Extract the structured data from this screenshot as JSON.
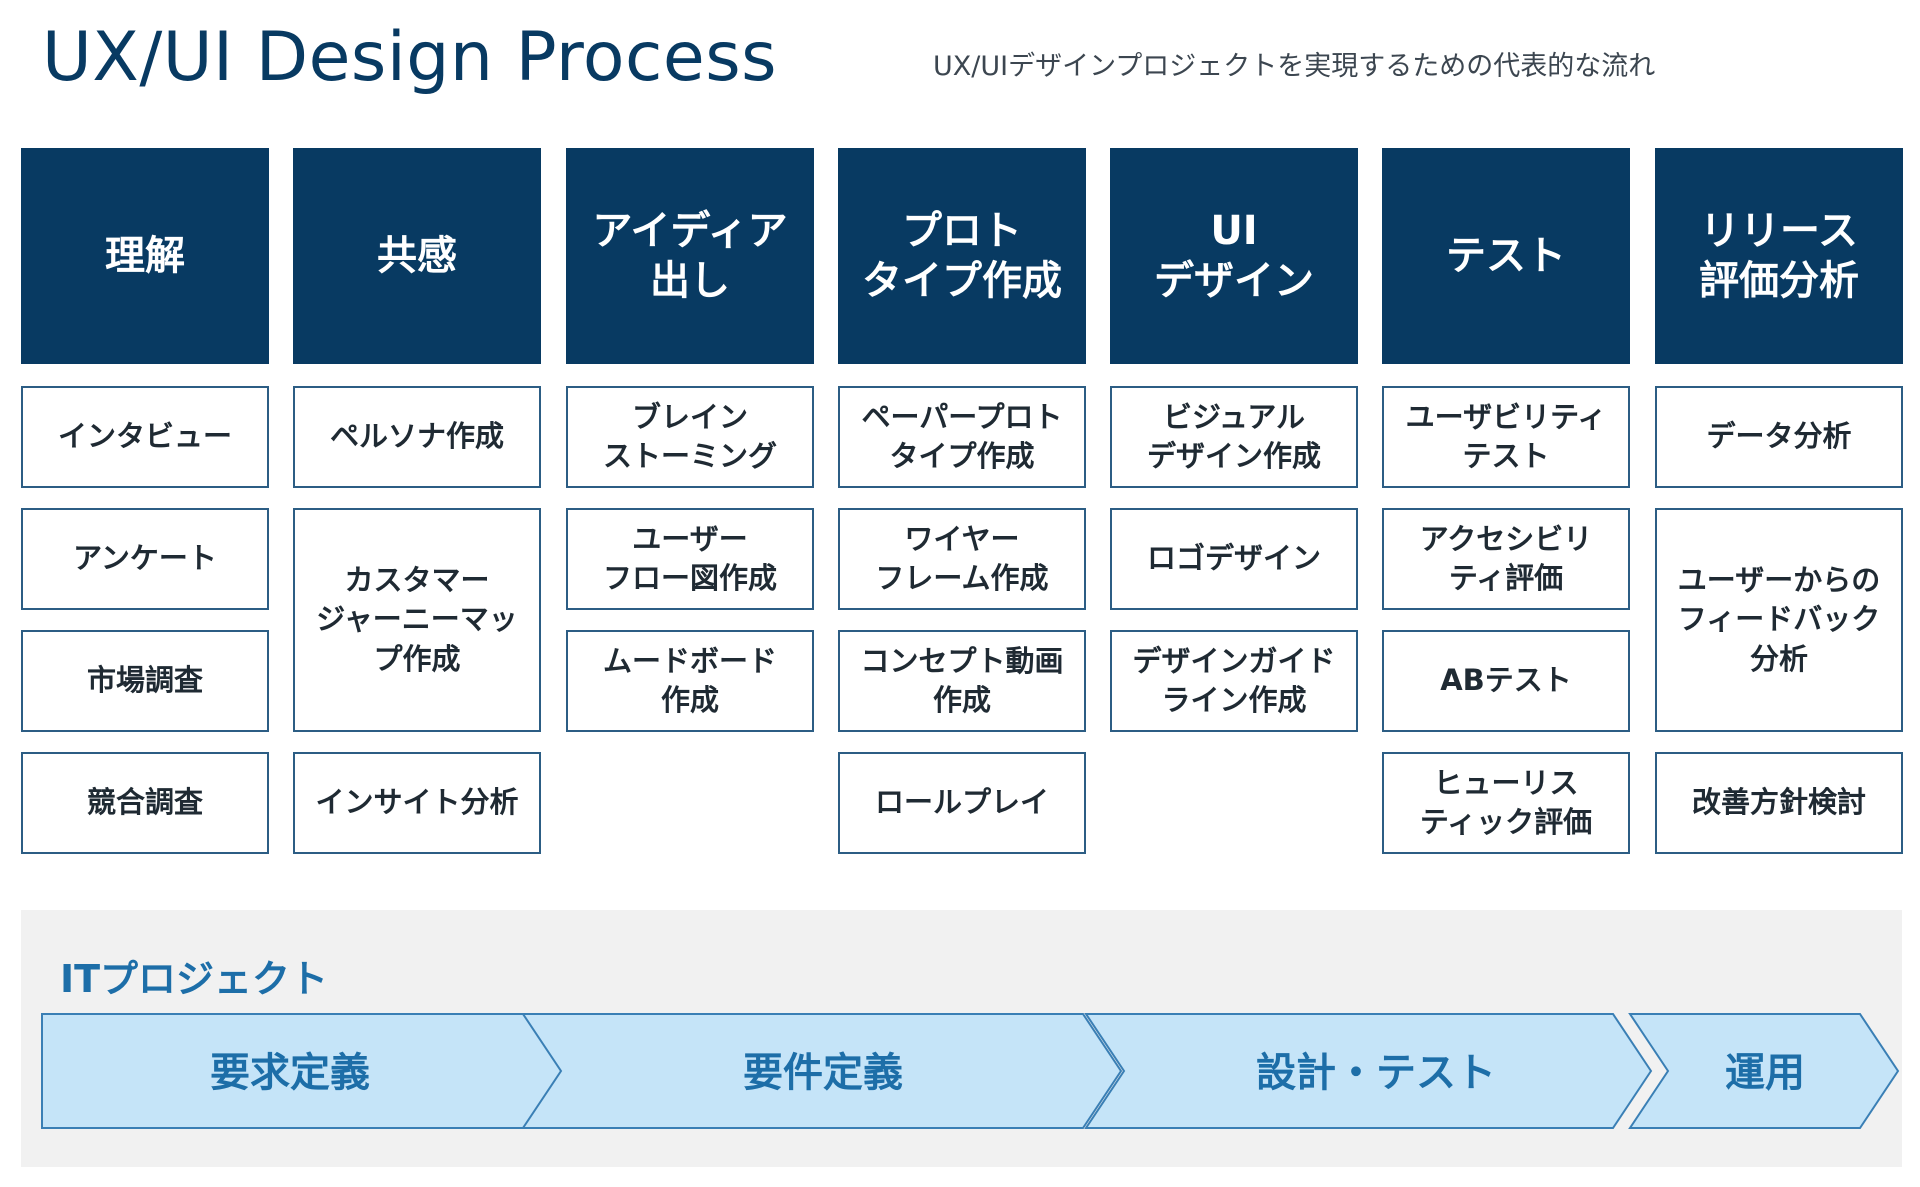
{
  "header": {
    "title": "UX/UI Design Process",
    "subtitle": "UX/UIデザインプロジェクトを実現するための代表的な流れ"
  },
  "phases": [
    {
      "label": "理解",
      "items": [
        "インタビュー",
        "アンケート",
        "市場調査",
        "競合調査"
      ]
    },
    {
      "label": "共感",
      "items": [
        "ペルソナ作成",
        "カスタマー\nジャーニーマッ\nプ作成",
        "インサイト分析"
      ]
    },
    {
      "label": "アイディア\n出し",
      "items": [
        "ブレイン\nストーミング",
        "ユーザー\nフロー図作成",
        "ムードボード\n作成"
      ]
    },
    {
      "label": "プロト\nタイプ作成",
      "items": [
        "ペーパープロト\nタイプ作成",
        "ワイヤー\nフレーム作成",
        "コンセプト動画\n作成",
        "ロールプレイ"
      ]
    },
    {
      "label": "UI\nデザイン",
      "items": [
        "ビジュアル\nデザイン作成",
        "ロゴデザイン",
        "デザインガイド\nライン作成"
      ]
    },
    {
      "label": "テスト",
      "items": [
        "ユーザビリティ\nテスト",
        "アクセシビリ\nティ評価",
        "ABテスト",
        "ヒューリス\nティック評価"
      ]
    },
    {
      "label": "リリース\n評価分析",
      "items": [
        "データ分析",
        "ユーザーからの\nフィードバック\n分析",
        "改善方針検討"
      ]
    }
  ],
  "it_project": {
    "title": "ITプロジェクト",
    "stages": [
      "要求定義",
      "要件定義",
      "設計・テスト",
      "運用"
    ]
  },
  "colors": {
    "header_bg": "#083a62",
    "cell_border": "#2c5d84",
    "arrow_fill": "#c5e4f8",
    "arrow_stroke": "#3a7fb5",
    "arrow_text": "#1d6ea8",
    "it_title": "#1d6ea8",
    "panel_bg": "#f1f1f1"
  }
}
